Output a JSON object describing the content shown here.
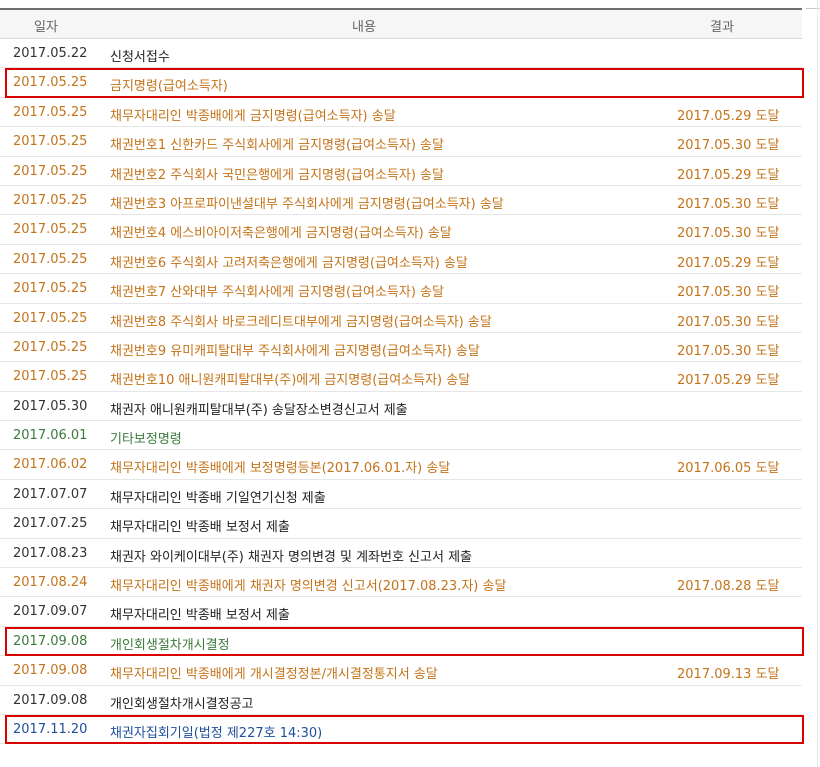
{
  "header": {
    "date": "일자",
    "content": "내용",
    "result": "결과"
  },
  "rows": [
    {
      "date": "2017.05.22",
      "content": "신청서접수",
      "result": "",
      "style": "black",
      "highlight": false
    },
    {
      "date": "2017.05.25",
      "content": "금지명령(급여소득자)",
      "result": "",
      "style": "orange",
      "highlight": true
    },
    {
      "date": "2017.05.25",
      "content": "채무자대리인 박종배에게 금지명령(급여소득자) 송달",
      "result": "2017.05.29 도달",
      "style": "orange",
      "highlight": false
    },
    {
      "date": "2017.05.25",
      "content": "채권번호1 신한카드 주식회사에게 금지명령(급여소득자) 송달",
      "result": "2017.05.30 도달",
      "style": "orange",
      "highlight": false
    },
    {
      "date": "2017.05.25",
      "content": "채권번호2 주식회사 국민은행에게 금지명령(급여소득자) 송달",
      "result": "2017.05.29 도달",
      "style": "orange",
      "highlight": false
    },
    {
      "date": "2017.05.25",
      "content": "채권번호3 아프로파이낸셜대부 주식회사에게 금지명령(급여소득자) 송달",
      "result": "2017.05.30 도달",
      "style": "orange",
      "highlight": false
    },
    {
      "date": "2017.05.25",
      "content": "채권번호4 에스비아이저축은행에게 금지명령(급여소득자) 송달",
      "result": "2017.05.30 도달",
      "style": "orange",
      "highlight": false
    },
    {
      "date": "2017.05.25",
      "content": "채권번호6 주식회사 고려저축은행에게 금지명령(급여소득자) 송달",
      "result": "2017.05.29 도달",
      "style": "orange",
      "highlight": false
    },
    {
      "date": "2017.05.25",
      "content": "채권번호7 산와대부 주식회사에게 금지명령(급여소득자) 송달",
      "result": "2017.05.30 도달",
      "style": "orange",
      "highlight": false
    },
    {
      "date": "2017.05.25",
      "content": "채권번호8 주식회사 바로크레디트대부에게 금지명령(급여소득자) 송달",
      "result": "2017.05.30 도달",
      "style": "orange",
      "highlight": false
    },
    {
      "date": "2017.05.25",
      "content": "채권번호9 유미캐피탈대부 주식회사에게 금지명령(급여소득자) 송달",
      "result": "2017.05.30 도달",
      "style": "orange",
      "highlight": false
    },
    {
      "date": "2017.05.25",
      "content": "채권번호10 애니원캐피탈대부(주)에게 금지명령(급여소득자) 송달",
      "result": "2017.05.29 도달",
      "style": "orange",
      "highlight": false
    },
    {
      "date": "2017.05.30",
      "content": "채권자 애니원캐피탈대부(주) 송달장소변경신고서 제출",
      "result": "",
      "style": "black",
      "highlight": false
    },
    {
      "date": "2017.06.01",
      "content": "기타보정명령",
      "result": "",
      "style": "green",
      "highlight": false
    },
    {
      "date": "2017.06.02",
      "content": "채무자대리인 박종배에게 보정명령등본(2017.06.01.자) 송달",
      "result": "2017.06.05 도달",
      "style": "orange",
      "highlight": false
    },
    {
      "date": "2017.07.07",
      "content": "채무자대리인 박종배 기일연기신청 제출",
      "result": "",
      "style": "black",
      "highlight": false
    },
    {
      "date": "2017.07.25",
      "content": "채무자대리인 박종배 보정서 제출",
      "result": "",
      "style": "black",
      "highlight": false
    },
    {
      "date": "2017.08.23",
      "content": "채권자 와이케이대부(주) 채권자 명의변경 및 계좌번호 신고서 제출",
      "result": "",
      "style": "black",
      "highlight": false
    },
    {
      "date": "2017.08.24",
      "content": "채무자대리인 박종배에게 채권자 명의변경 신고서(2017.08.23.자) 송달",
      "result": "2017.08.28 도달",
      "style": "orange",
      "highlight": false
    },
    {
      "date": "2017.09.07",
      "content": "채무자대리인 박종배 보정서 제출",
      "result": "",
      "style": "black",
      "highlight": false
    },
    {
      "date": "2017.09.08",
      "content": "개인회생절차개시결정",
      "result": "",
      "style": "green",
      "highlight": true
    },
    {
      "date": "2017.09.08",
      "content": "채무자대리인 박종배에게 개시결정정본/개시결정통지서 송달",
      "result": "2017.09.13 도달",
      "style": "orange",
      "highlight": false
    },
    {
      "date": "2017.09.08",
      "content": "개인회생절차개시결정공고",
      "result": "",
      "style": "black",
      "highlight": false
    },
    {
      "date": "2017.11.20",
      "content": "채권자집회기일(법정 제227호 14:30)",
      "result": "",
      "style": "blue",
      "highlight": true
    }
  ]
}
